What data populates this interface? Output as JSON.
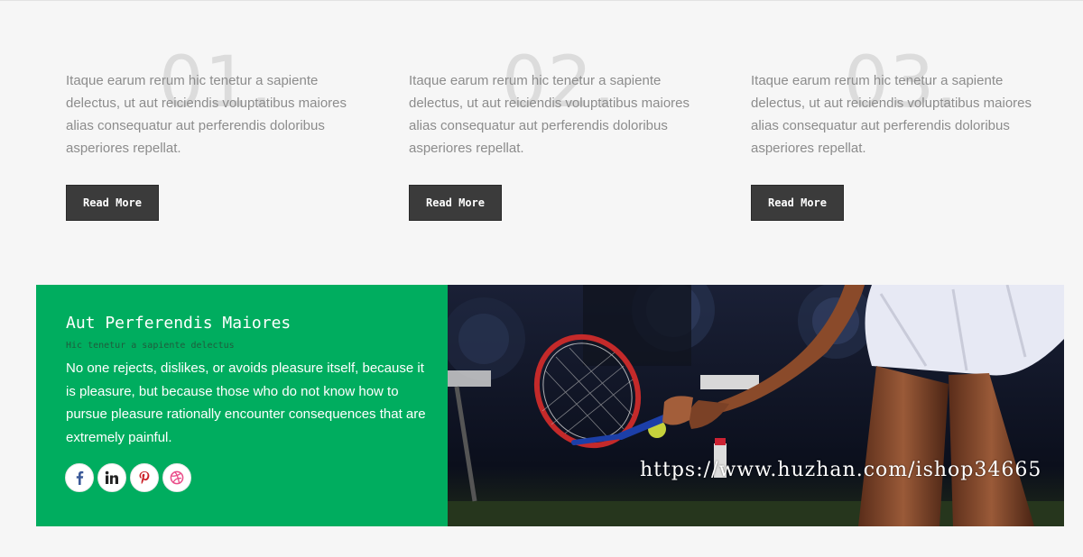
{
  "columns": [
    {
      "number": "01.",
      "text": "Itaque earum rerum hic tenetur a sapiente delectus, ut aut reiciendis voluptatibus maiores alias consequatur aut perferendis doloribus asperiores repellat.",
      "button_label": "Read More"
    },
    {
      "number": "02.",
      "text": "Itaque earum rerum hic tenetur a sapiente delectus, ut aut reiciendis voluptatibus maiores alias consequatur aut perferendis doloribus asperiores repellat.",
      "button_label": "Read More"
    },
    {
      "number": "03.",
      "text": "Itaque earum rerum hic tenetur a sapiente delectus, ut aut reiciendis voluptatibus maiores alias consequatur aut perferendis doloribus asperiores repellat.",
      "button_label": "Read More"
    }
  ],
  "feature": {
    "title": "Aut Perferendis Maiores",
    "subtitle": "Hic tenetur a sapiente delectus",
    "body": "No one rejects, dislikes, or avoids pleasure itself, because it is pleasure, but because those who do not know how to pursue pleasure rationally encounter consequences that are extremely painful.",
    "social_icons": [
      "facebook-icon",
      "linkedin-icon",
      "pinterest-icon",
      "dribbble-icon"
    ],
    "watermark": "https://www.huzhan.com/ishop34665"
  },
  "colors": {
    "accent_green": "#00ad5f",
    "button_dark": "#3b3b3b",
    "page_background": "#f6f6f6"
  }
}
